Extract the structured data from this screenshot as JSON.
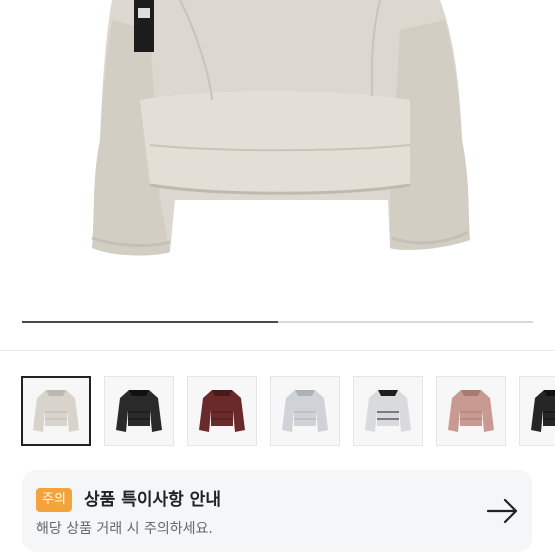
{
  "gallery": {
    "progress_fraction": 0.5
  },
  "thumbnails": [
    {
      "name": "thumb-beige-jacket",
      "color": "#d8d4cb",
      "dark": "#bdb8ae",
      "selected": true
    },
    {
      "name": "thumb-black-jacket",
      "color": "#2a2a2a",
      "dark": "#111111",
      "selected": false
    },
    {
      "name": "thumb-burgundy-jacket",
      "color": "#6b2a2a",
      "dark": "#4a1a1a",
      "selected": false
    },
    {
      "name": "thumb-silver-jacket",
      "color": "#cfd2d6",
      "dark": "#aeb2b8",
      "selected": false
    },
    {
      "name": "thumb-silver-black-jacket",
      "color": "#d8dadd",
      "dark": "#1e1e1e",
      "selected": false
    },
    {
      "name": "thumb-pink-jacket",
      "color": "#c99a92",
      "dark": "#a77a72",
      "selected": false
    },
    {
      "name": "thumb-black-jacket-2",
      "color": "#262626",
      "dark": "#111111",
      "selected": false
    }
  ],
  "notice": {
    "badge": "주의",
    "title": "상품 특이사항 안내",
    "description": "해당 상품 거래 시 주의하세요."
  },
  "colors": {
    "badge": "#f3a33b",
    "card_background": "#f5f6f8"
  }
}
